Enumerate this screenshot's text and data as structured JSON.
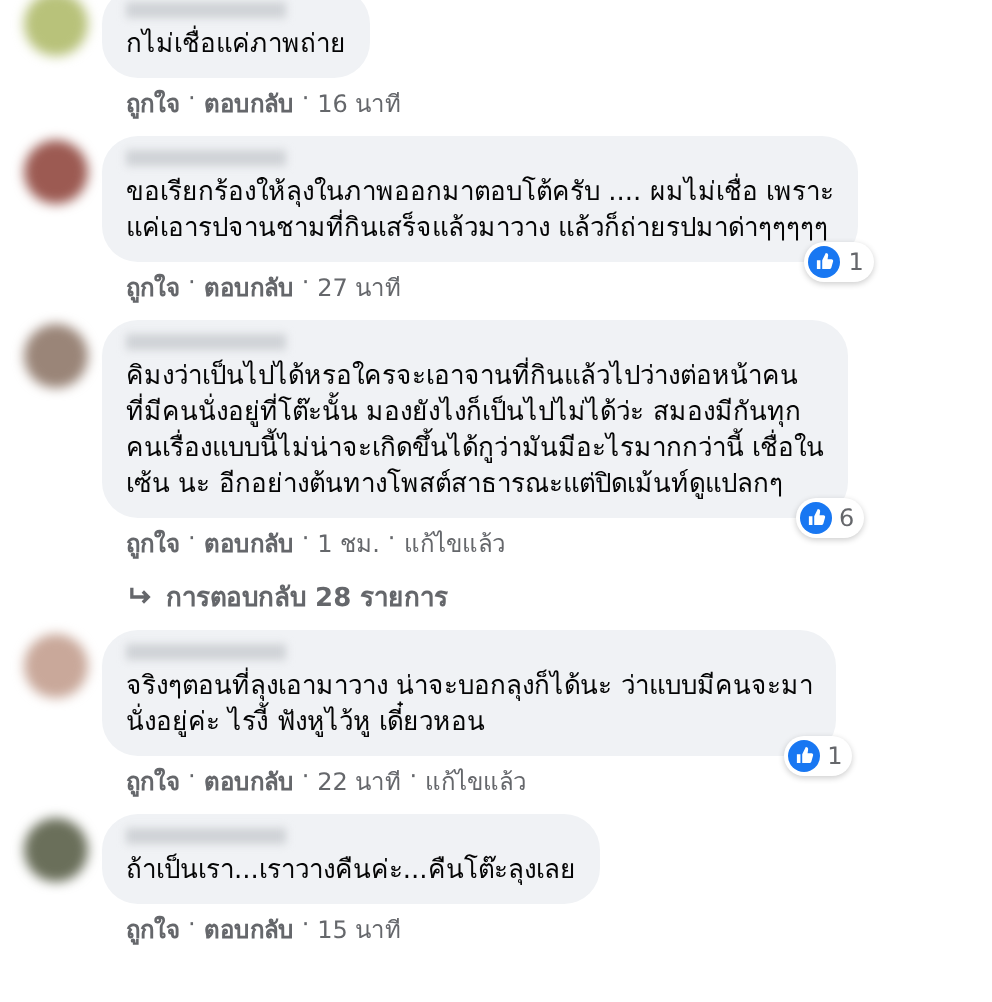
{
  "comments": [
    {
      "text": "กไม่เชื่อแค่ภาพถ่าย",
      "meta": [
        {
          "kind": "action",
          "text": "ถูกใจ"
        },
        {
          "kind": "sep",
          "text": "·"
        },
        {
          "kind": "action",
          "text": "ตอบกลับ"
        },
        {
          "kind": "sep",
          "text": "·"
        },
        {
          "kind": "time",
          "text": "16 นาที"
        }
      ]
    },
    {
      "text": "ขอเรียกร้องให้ลุงในภาพออกมาตอบโต้ครับ .... ผมไม่เชื่อ เพราะ\nแค่เอารปจานชามที่กินเสร็จแล้วมาวาง แล้วก็ถ่ายรปมาด่าๆๆๆๆๆ",
      "reactions": "1",
      "meta": [
        {
          "kind": "action",
          "text": "ถูกใจ"
        },
        {
          "kind": "sep",
          "text": "·"
        },
        {
          "kind": "action",
          "text": "ตอบกลับ"
        },
        {
          "kind": "sep",
          "text": "·"
        },
        {
          "kind": "time",
          "text": "27 นาที"
        }
      ]
    },
    {
      "text": "คิมงว่าเป็นไปได้หรอใครจะเอาจานที่กินแล้วไปว่างต่อหน้าคน\nที่มีคนนั่งอยู่ที่โต๊ะนั้น มองยังไงก็เป็นไปไม่ได้ว่ะ สมองมีกันทุก\nคนเรื่องแบบนี้ไม่น่าจะเกิดขึ้นได้กูว่ามันมีอะไรมากกว่านี้ เชื่อใน\nเซ้น นะ อีกอย่างต้นทางโพสต์สาธารณะแต่ปิดเม้นท์ดูแปลกๆ",
      "reactions": "6",
      "meta": [
        {
          "kind": "action",
          "text": "ถูกใจ"
        },
        {
          "kind": "sep",
          "text": "·"
        },
        {
          "kind": "action",
          "text": "ตอบกลับ"
        },
        {
          "kind": "sep",
          "text": "·"
        },
        {
          "kind": "time",
          "text": "1 ชม."
        },
        {
          "kind": "sep",
          "text": "·"
        },
        {
          "kind": "edited",
          "text": "แก้ไขแล้ว"
        }
      ]
    },
    {
      "kind": "replies",
      "text": "การตอบกลับ 28 รายการ"
    },
    {
      "text": "จริงๆตอนที่ลุงเอามาวาง น่าจะบอกลุงก็ได้นะ ว่าแบบมีคนจะมา\nนั่งอยู่ค่ะ ไรงี้ ฟังหูไว้หู เดี๋ยวหอน",
      "reactions": "1",
      "meta": [
        {
          "kind": "action",
          "text": "ถูกใจ"
        },
        {
          "kind": "sep",
          "text": "·"
        },
        {
          "kind": "action",
          "text": "ตอบกลับ"
        },
        {
          "kind": "sep",
          "text": "·"
        },
        {
          "kind": "time",
          "text": "22 นาที"
        },
        {
          "kind": "sep",
          "text": "·"
        },
        {
          "kind": "edited",
          "text": "แก้ไขแล้ว"
        }
      ]
    },
    {
      "text": "ถ้าเป็นเรา...เราวางคืนค่ะ...คืนโต๊ะลุงเลย",
      "meta": [
        {
          "kind": "action",
          "text": "ถูกใจ"
        },
        {
          "kind": "sep",
          "text": "·"
        },
        {
          "kind": "action",
          "text": "ตอบกลับ"
        },
        {
          "kind": "sep",
          "text": "·"
        },
        {
          "kind": "time",
          "text": "15 นาที"
        }
      ]
    }
  ]
}
